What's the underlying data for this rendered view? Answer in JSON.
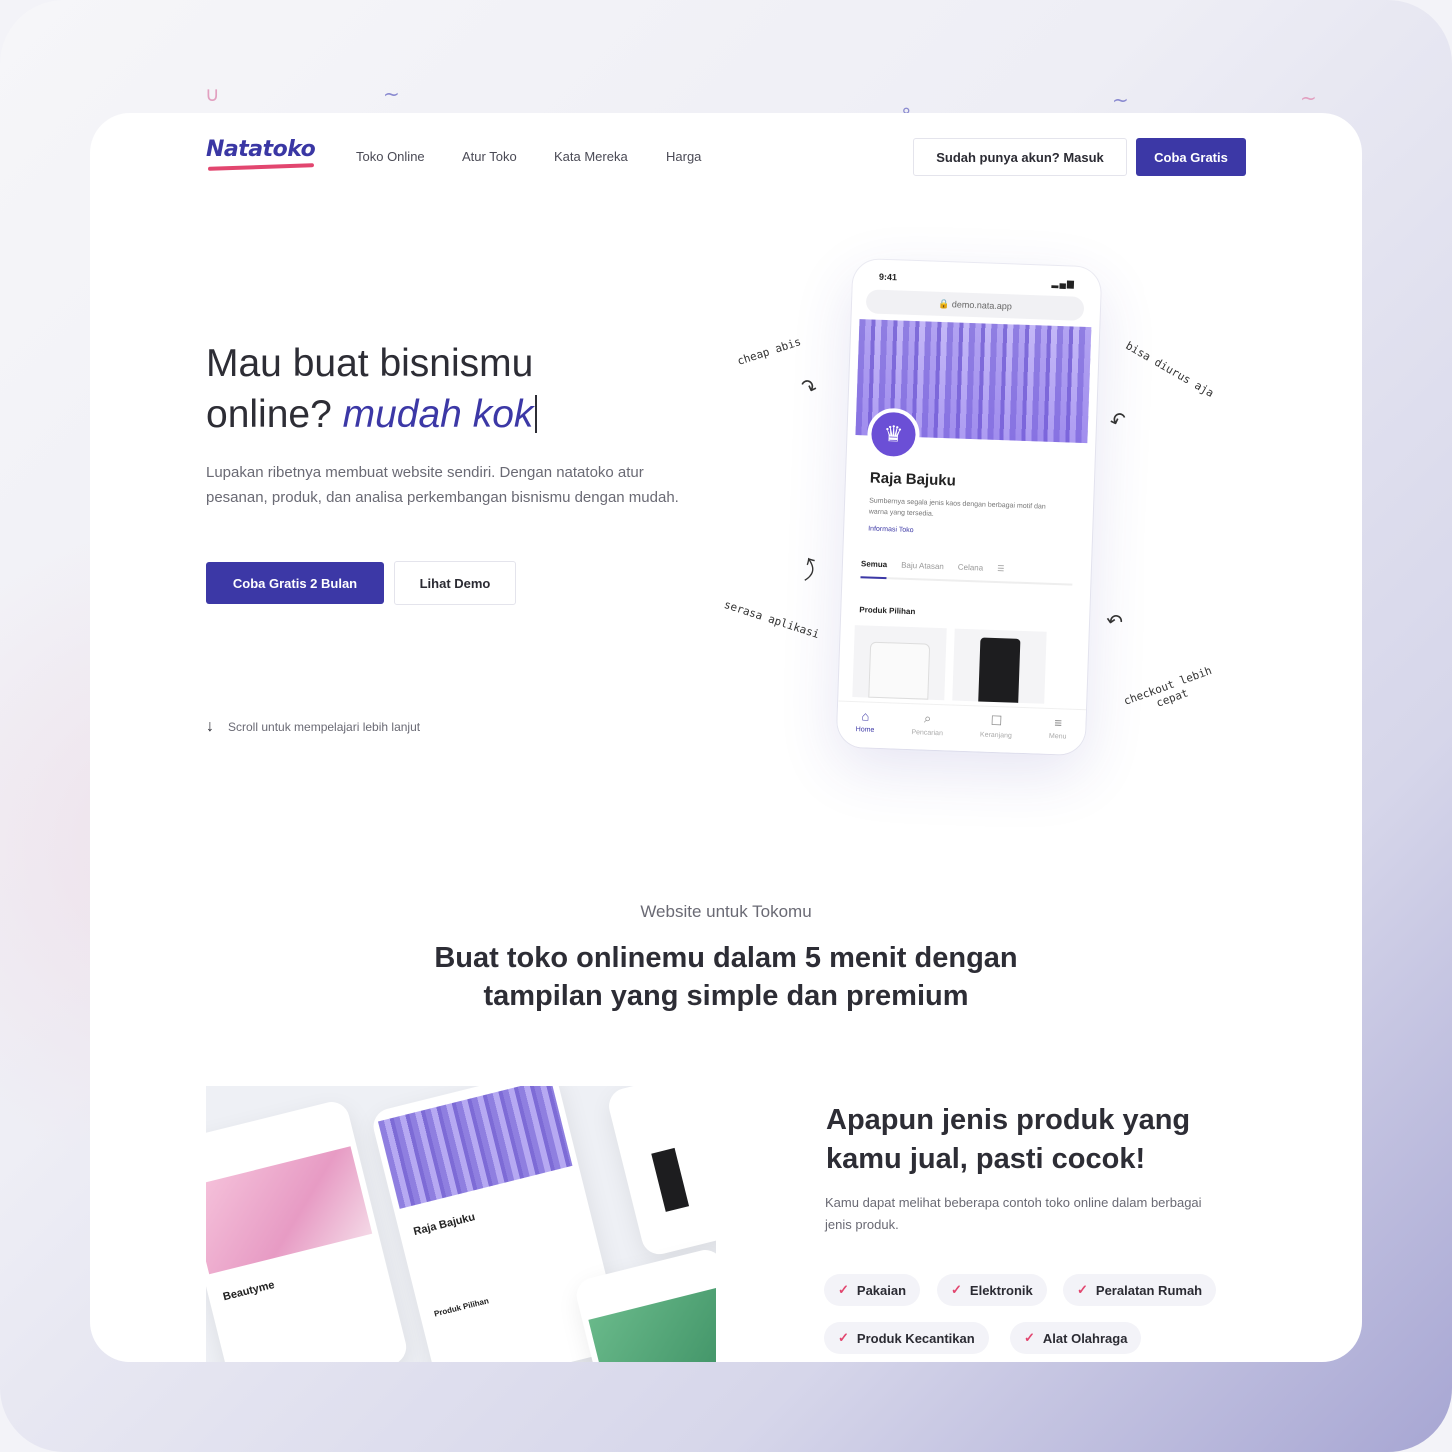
{
  "brand": {
    "logo": "Natatoko",
    "primary": "#3c38a6",
    "accent": "#e2466f"
  },
  "nav": {
    "links": [
      "Toko Online",
      "Atur Toko",
      "Kata Mereka",
      "Harga"
    ],
    "login_label": "Sudah punya akun? Masuk",
    "try_label": "Coba Gratis"
  },
  "hero": {
    "title_line1": "Mau buat bisnismu",
    "title_line2_plain": "online?",
    "title_line2_emph": "mudah kok",
    "description": "Lupakan ribetnya membuat website sendiri. Dengan natatoko atur pesanan, produk, dan analisa perkembangan bisnismu dengan mudah.",
    "cta_primary": "Coba Gratis 2 Bulan",
    "cta_secondary": "Lihat Demo",
    "scroll_hint": "Scroll untuk mempelajari lebih lanjut"
  },
  "phone": {
    "time": "9:41",
    "signal": "▂▄▆",
    "url": "🔒 demo.nata.app",
    "store_name": "Raja Bajuku",
    "store_desc": "Sumbernya segala jenis kaos dengan berbagai motif dan warna yang tersedia.",
    "info_link": "Informasi Toko",
    "tabs": [
      "Semua",
      "Baju Atasan",
      "Celana"
    ],
    "section": "Produk Pilihan",
    "bottom_nav": [
      {
        "icon": "⌂",
        "label": "Home"
      },
      {
        "icon": "⌕",
        "label": "Pencarian"
      },
      {
        "icon": "☐",
        "label": "Keranjang"
      },
      {
        "icon": "≡",
        "label": "Menu"
      }
    ]
  },
  "annotations": {
    "cheap": "cheap abis",
    "easy": "bisa diurus aja",
    "app": "serasa aplikasi",
    "checkout": "checkout lebih cepat"
  },
  "section2": {
    "eyebrow": "Website untuk Tokomu",
    "title": "Buat toko onlinemu dalam 5 menit dengan tampilan yang simple dan premium"
  },
  "gallery": {
    "store1": "Beautyme",
    "store2": "Raja Bajuku",
    "store2_section": "Produk Pilihan"
  },
  "section3": {
    "title": "Apapun jenis produk yang kamu jual, pasti cocok!",
    "description": "Kamu dapat melihat beberapa contoh toko online dalam berbagai jenis produk.",
    "chips": [
      "Pakaian",
      "Elektronik",
      "Peralatan Rumah",
      "Produk Kecantikan",
      "Alat Olahraga"
    ]
  }
}
